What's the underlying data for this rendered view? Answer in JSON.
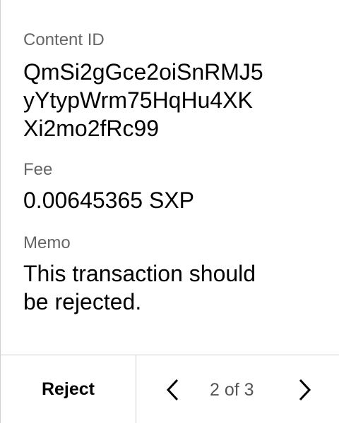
{
  "details": {
    "content_id": {
      "label": "Content ID",
      "value_lines": [
        "QmSi2gGce2oiSnRMJ5",
        "yYtypWrm75HqHu4XK",
        "Xi2mo2fRc99"
      ]
    },
    "fee": {
      "label": "Fee",
      "value": "0.00645365 SXP"
    },
    "memo": {
      "label": "Memo",
      "value_lines": [
        "This transaction should",
        "be rejected."
      ]
    }
  },
  "footer": {
    "reject_label": "Reject",
    "page_indicator": "2 of 3",
    "prev_icon": "chevron-left-icon",
    "next_icon": "chevron-right-icon"
  }
}
